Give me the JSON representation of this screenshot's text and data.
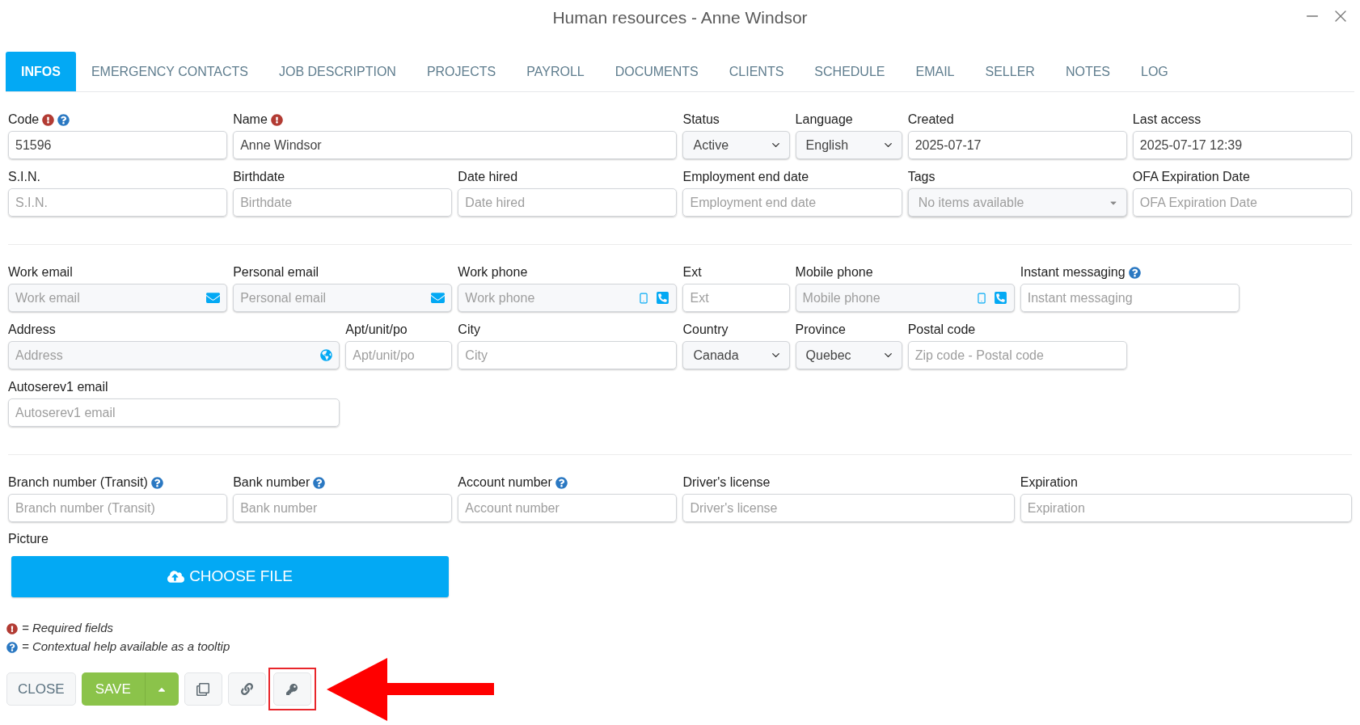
{
  "window": {
    "title": "Human resources - Anne Windsor"
  },
  "tabs": [
    {
      "label": "INFOS",
      "selected": true
    },
    {
      "label": "EMERGENCY CONTACTS",
      "selected": false
    },
    {
      "label": "JOB DESCRIPTION",
      "selected": false
    },
    {
      "label": "PROJECTS",
      "selected": false
    },
    {
      "label": "PAYROLL",
      "selected": false
    },
    {
      "label": "DOCUMENTS",
      "selected": false
    },
    {
      "label": "CLIENTS",
      "selected": false
    },
    {
      "label": "SCHEDULE",
      "selected": false
    },
    {
      "label": "EMAIL",
      "selected": false
    },
    {
      "label": "SELLER",
      "selected": false
    },
    {
      "label": "NOTES",
      "selected": false
    },
    {
      "label": "LOG",
      "selected": false
    }
  ],
  "sections": [
    {
      "fields": [
        {
          "label": "Code",
          "kind": "text",
          "value": "51596",
          "required": true,
          "help": true
        },
        {
          "label": "Name",
          "kind": "text",
          "value": "Anne Windsor",
          "required": true,
          "help": false
        },
        {
          "label": "Status",
          "kind": "select",
          "value": "Active",
          "required": false,
          "help": false
        },
        {
          "label": "Language",
          "kind": "select",
          "value": "English",
          "required": false,
          "help": false
        },
        {
          "label": "Created",
          "kind": "readonly",
          "value": "2025-07-17",
          "required": false,
          "help": false
        },
        {
          "label": "Last access",
          "kind": "readonly",
          "value": "2025-07-17 12:39",
          "required": false,
          "help": false
        },
        {
          "label": "S.I.N.",
          "kind": "text",
          "placeholder": "S.I.N.",
          "required": false,
          "help": false
        },
        {
          "label": "Birthdate",
          "kind": "text",
          "placeholder": "Birthdate",
          "required": false,
          "help": false
        },
        {
          "label": "Date hired",
          "kind": "text",
          "placeholder": "Date hired",
          "required": false,
          "help": false
        },
        {
          "label": "Employment end date",
          "kind": "text",
          "placeholder": "Employment end date",
          "required": false,
          "help": false
        },
        {
          "label": "Tags",
          "kind": "tags",
          "placeholder": "No items available",
          "required": false,
          "help": false
        },
        {
          "label": "OFA Expiration Date",
          "kind": "text",
          "placeholder": "OFA Expiration Date",
          "required": false,
          "help": false
        }
      ]
    },
    {
      "fields": [
        {
          "label": "Work email",
          "kind": "email",
          "placeholder": "Work email",
          "required": false,
          "help": false
        },
        {
          "label": "Personal email",
          "kind": "email",
          "placeholder": "Personal email",
          "required": false,
          "help": false
        },
        {
          "label": "Work phone",
          "kind": "phone",
          "placeholder": "Work phone",
          "required": false,
          "help": false
        },
        {
          "label": "Ext",
          "kind": "text",
          "placeholder": "Ext",
          "required": false,
          "help": false
        },
        {
          "label": "Mobile phone",
          "kind": "phone",
          "placeholder": "Mobile phone",
          "required": false,
          "help": false
        },
        {
          "label": "Instant messaging",
          "kind": "text",
          "placeholder": "Instant messaging",
          "required": false,
          "help": true
        },
        {
          "label": "Address",
          "kind": "address",
          "placeholder": "Address",
          "required": false,
          "help": false
        },
        {
          "label": "Apt/unit/po",
          "kind": "text",
          "placeholder": "Apt/unit/po",
          "required": false,
          "help": false
        },
        {
          "label": "City",
          "kind": "text",
          "placeholder": "City",
          "required": false,
          "help": false
        },
        {
          "label": "Country",
          "kind": "select",
          "value": "Canada",
          "required": false,
          "help": false
        },
        {
          "label": "Province",
          "kind": "select",
          "value": "Quebec",
          "required": false,
          "help": false
        },
        {
          "label": "Postal code",
          "kind": "text",
          "placeholder": "Zip code - Postal code",
          "required": false,
          "help": false
        },
        {
          "label": "Autoserev1 email",
          "kind": "text",
          "placeholder": "Autoserev1 email",
          "required": false,
          "help": false
        }
      ]
    },
    {
      "fields": [
        {
          "label": "Branch number (Transit)",
          "kind": "text",
          "placeholder": "Branch number (Transit)",
          "required": false,
          "help": true
        },
        {
          "label": "Bank number",
          "kind": "text",
          "placeholder": "Bank number",
          "required": false,
          "help": true
        },
        {
          "label": "Account number",
          "kind": "text",
          "placeholder": "Account number",
          "required": false,
          "help": true
        },
        {
          "label": "Driver's license",
          "kind": "text",
          "placeholder": "Driver's license",
          "required": false,
          "help": false
        },
        {
          "label": "Expiration",
          "kind": "text",
          "placeholder": "Expiration",
          "required": false,
          "help": false
        }
      ]
    }
  ],
  "picture": {
    "label": "Picture",
    "button": "CHOOSE FILE"
  },
  "legend": [
    {
      "kind": "required",
      "text": "= Required fields"
    },
    {
      "kind": "help",
      "text": "= Contextual help available as a tooltip"
    }
  ],
  "actions": [
    {
      "kind": "button",
      "label": "CLOSE",
      "callout": false
    },
    {
      "kind": "split",
      "label": "SAVE",
      "callout": false
    },
    {
      "kind": "copy",
      "callout": false
    },
    {
      "kind": "link",
      "callout": false
    },
    {
      "kind": "key",
      "callout": true
    }
  ]
}
